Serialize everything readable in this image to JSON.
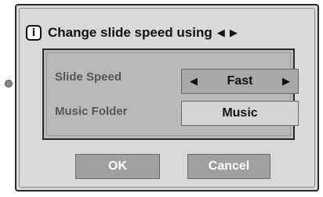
{
  "dialog": {
    "title": "Change slide speed using",
    "title_arrows": "◀ ▶",
    "info_icon": "i"
  },
  "settings": [
    {
      "label": "Slide Speed",
      "value": "Fast",
      "left_arrow": "◀",
      "right_arrow": "▶"
    },
    {
      "label": "Music Folder",
      "value": "Music"
    }
  ],
  "buttons": {
    "ok": "OK",
    "cancel": "Cancel"
  }
}
